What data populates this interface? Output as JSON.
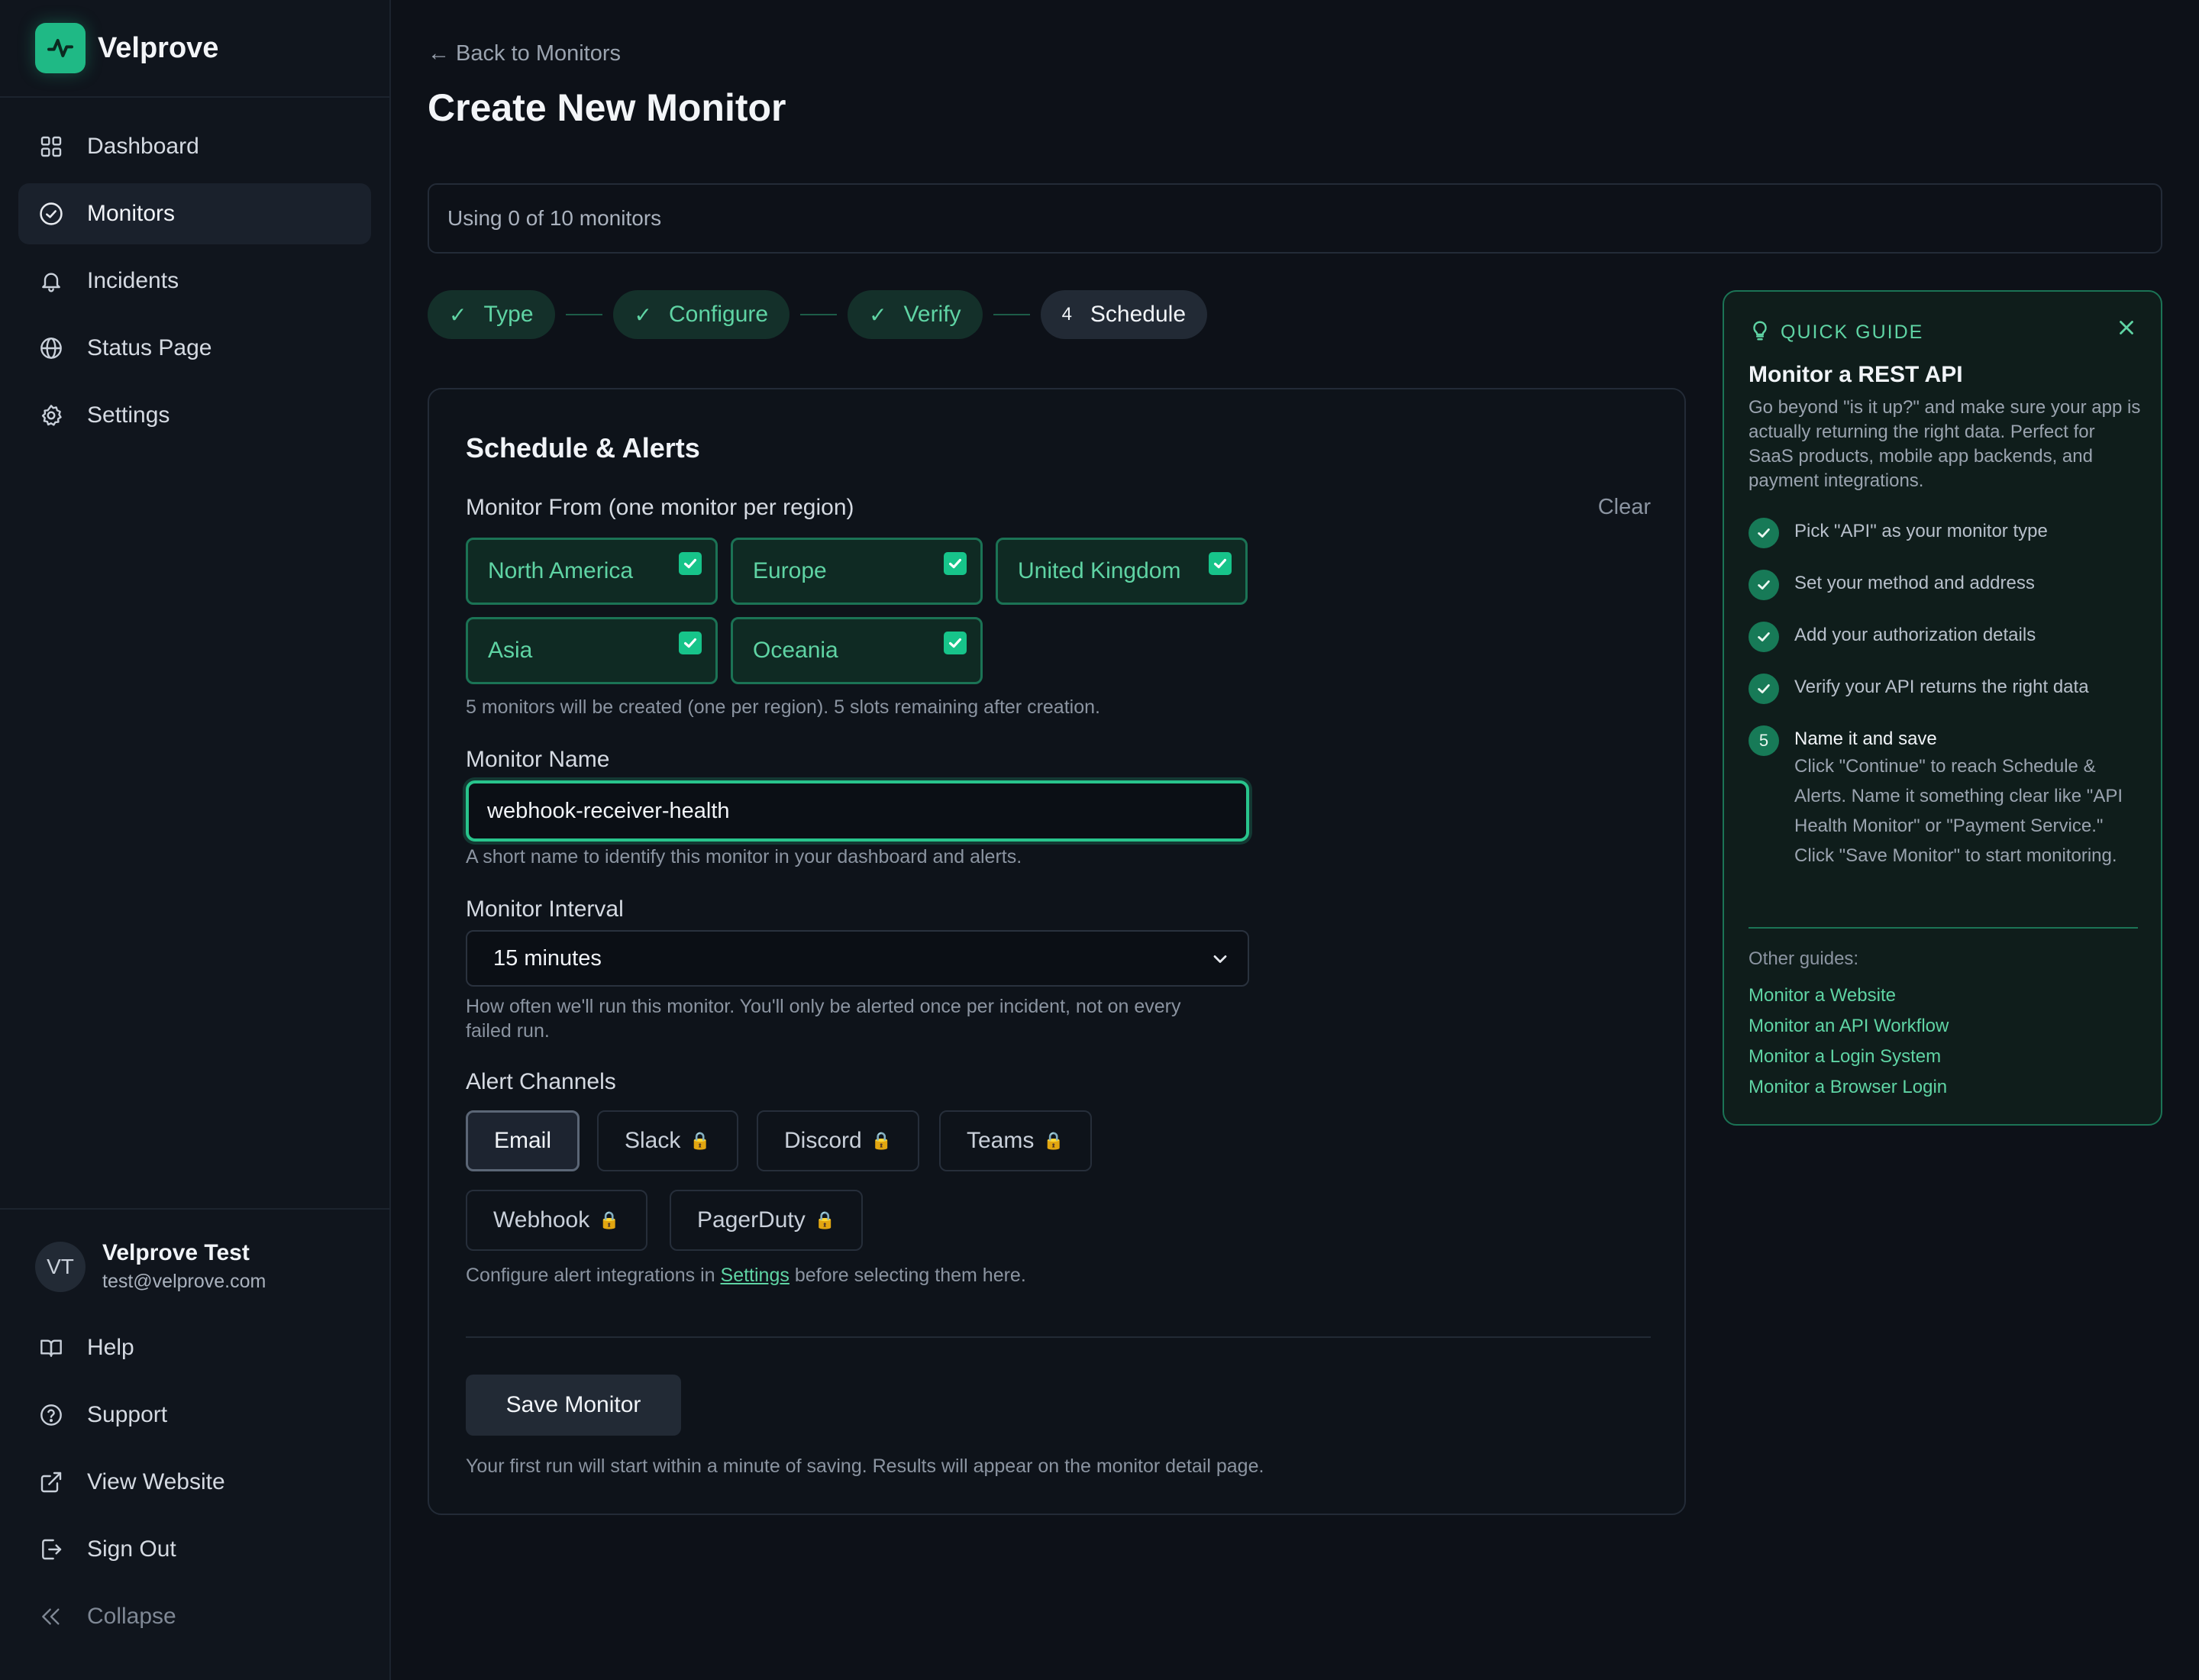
{
  "brand": {
    "name": "Velprove"
  },
  "sidebar": {
    "items": [
      {
        "label": "Dashboard",
        "icon": "grid-icon",
        "active": false
      },
      {
        "label": "Monitors",
        "icon": "check-circle-icon",
        "active": true
      },
      {
        "label": "Incidents",
        "icon": "bell-icon",
        "active": false
      },
      {
        "label": "Status Page",
        "icon": "globe-icon",
        "active": false
      },
      {
        "label": "Settings",
        "icon": "gear-icon",
        "active": false
      }
    ],
    "user": {
      "initials": "VT",
      "name": "Velprove Test",
      "email": "test@velprove.com"
    },
    "bottom": [
      {
        "label": "Help",
        "icon": "book-icon"
      },
      {
        "label": "Support",
        "icon": "help-circle-icon"
      },
      {
        "label": "View Website",
        "icon": "external-link-icon"
      },
      {
        "label": "Sign Out",
        "icon": "sign-out-icon"
      },
      {
        "label": "Collapse",
        "icon": "chevrons-left-icon"
      }
    ]
  },
  "header": {
    "back_link": "← Back to Monitors",
    "title": "Create New Monitor",
    "usage": "Using 0 of 10 monitors"
  },
  "stepper": [
    {
      "label": "Type",
      "done": true
    },
    {
      "label": "Configure",
      "done": true
    },
    {
      "label": "Verify",
      "done": true
    },
    {
      "label": "Schedule",
      "done": false,
      "number": "4"
    }
  ],
  "form": {
    "title": "Schedule & Alerts",
    "regions_label": "Monitor From (one monitor per region)",
    "clear_label": "Clear",
    "regions": [
      {
        "label": "North America",
        "checked": true
      },
      {
        "label": "Europe",
        "checked": true
      },
      {
        "label": "United Kingdom",
        "checked": true
      },
      {
        "label": "Asia",
        "checked": true
      },
      {
        "label": "Oceania",
        "checked": true
      }
    ],
    "regions_hint": "5 monitors will be created (one per region). 5 slots remaining after creation.",
    "name_label": "Monitor Name",
    "name_value": "webhook-receiver-health",
    "name_hint": "A short name to identify this monitor in your dashboard and alerts.",
    "interval_label": "Monitor Interval",
    "interval_value": "15 minutes",
    "interval_hint_1": "How often we'll run this monitor. You'll only be alerted once per incident, not on every",
    "interval_hint_2": "failed run.",
    "channels_label": "Alert Channels",
    "channels": [
      {
        "label": "Email",
        "locked": false,
        "selected": true
      },
      {
        "label": "Slack",
        "locked": true,
        "selected": false
      },
      {
        "label": "Discord",
        "locked": true,
        "selected": false
      },
      {
        "label": "Teams",
        "locked": true,
        "selected": false
      },
      {
        "label": "Webhook",
        "locked": true,
        "selected": false
      },
      {
        "label": "PagerDuty",
        "locked": true,
        "selected": false
      }
    ],
    "lock_glyph": "🔒",
    "channels_hint_pre": "Configure alert integrations in ",
    "channels_hint_link": "Settings",
    "channels_hint_post": " before selecting them here.",
    "save_label": "Save Monitor",
    "save_hint": "Your first run will start within a minute of saving. Results will appear on the monitor detail page."
  },
  "guide": {
    "tag": "QUICK GUIDE",
    "title": "Monitor a REST API",
    "description": "Go beyond \"is it up?\" and make sure your app is actually returning the right data. Perfect for SaaS products, mobile app backends, and payment integrations.",
    "steps": [
      {
        "label": "Pick \"API\" as your monitor type",
        "done": true
      },
      {
        "label": "Set your method and address",
        "done": true
      },
      {
        "label": "Add your authorization details",
        "done": true
      },
      {
        "label": "Verify your API returns the right data",
        "done": true
      },
      {
        "label": "Name it and save",
        "done": false,
        "number": "5",
        "description": "Click \"Continue\" to reach Schedule & Alerts. Name it something clear like \"API Health Monitor\" or \"Payment Service.\" Click \"Save Monitor\" to start monitoring."
      }
    ],
    "other_label": "Other guides:",
    "other_links": [
      "Monitor a Website",
      "Monitor an API Workflow",
      "Monitor a Login System",
      "Monitor a Browser Login"
    ]
  },
  "colors": {
    "accent": "#1fb985",
    "accent_text": "#5fd4a4",
    "background": "#0d1118",
    "lock": "#e7a83a"
  }
}
